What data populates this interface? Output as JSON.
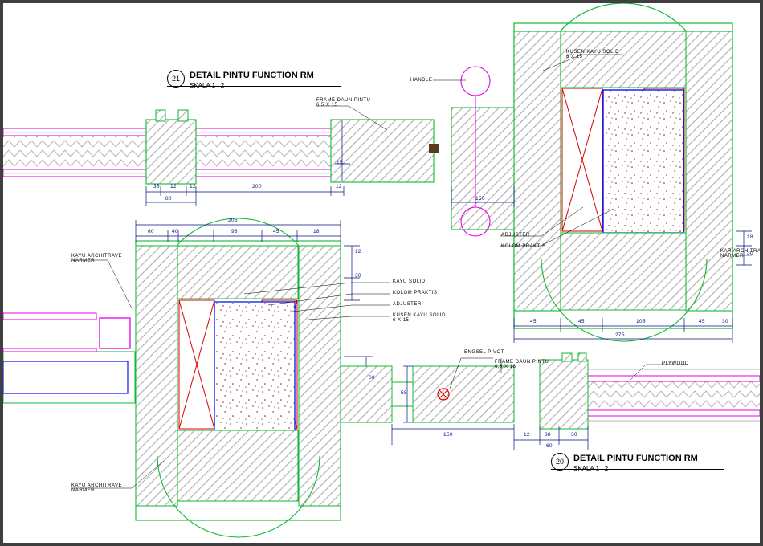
{
  "titles": {
    "t21": {
      "num": "21",
      "text": "DETAIL PINTU FUNCTION RM",
      "scale": "SKALA   1 : 2"
    },
    "t20": {
      "num": "20",
      "text": "DETAIL PINTU FUNCTION RM",
      "scale": "SKALA   1 : 2"
    }
  },
  "labels": {
    "handle": "HANDLE",
    "kusen_kayu": "KUSEN KAYU SOLID\n6 X 15",
    "frame_daun": "FRAME DAUN PINTU\n6,5 X 15",
    "adjuster": "ADJUSTER",
    "kolom": "KOLOM PRAKTIS",
    "kayu_solid": "KAYU SOLID",
    "kayu_architrave": "KAYU ARCHITRAVE\nNARMER",
    "kayu_architrave_r": "KAR ARCHITRAVE\nNARMER",
    "engsel": "ENGSEL PIVOT",
    "frame_eng": "FRAME DAUN PINTU\n6,5 X 18",
    "plywood": "PLYWOOD"
  },
  "dims": {
    "d205": "205",
    "d275": "275",
    "d150": "150",
    "d15": "15",
    "d38": "38",
    "d12": "12",
    "d60_a": "60",
    "d45": "45",
    "d105": "105",
    "d30": "30",
    "d80": "80",
    "d200": "200",
    "d60": "60",
    "d18": "18",
    "d150b": "150",
    "d40": "40",
    "d98": "98"
  }
}
